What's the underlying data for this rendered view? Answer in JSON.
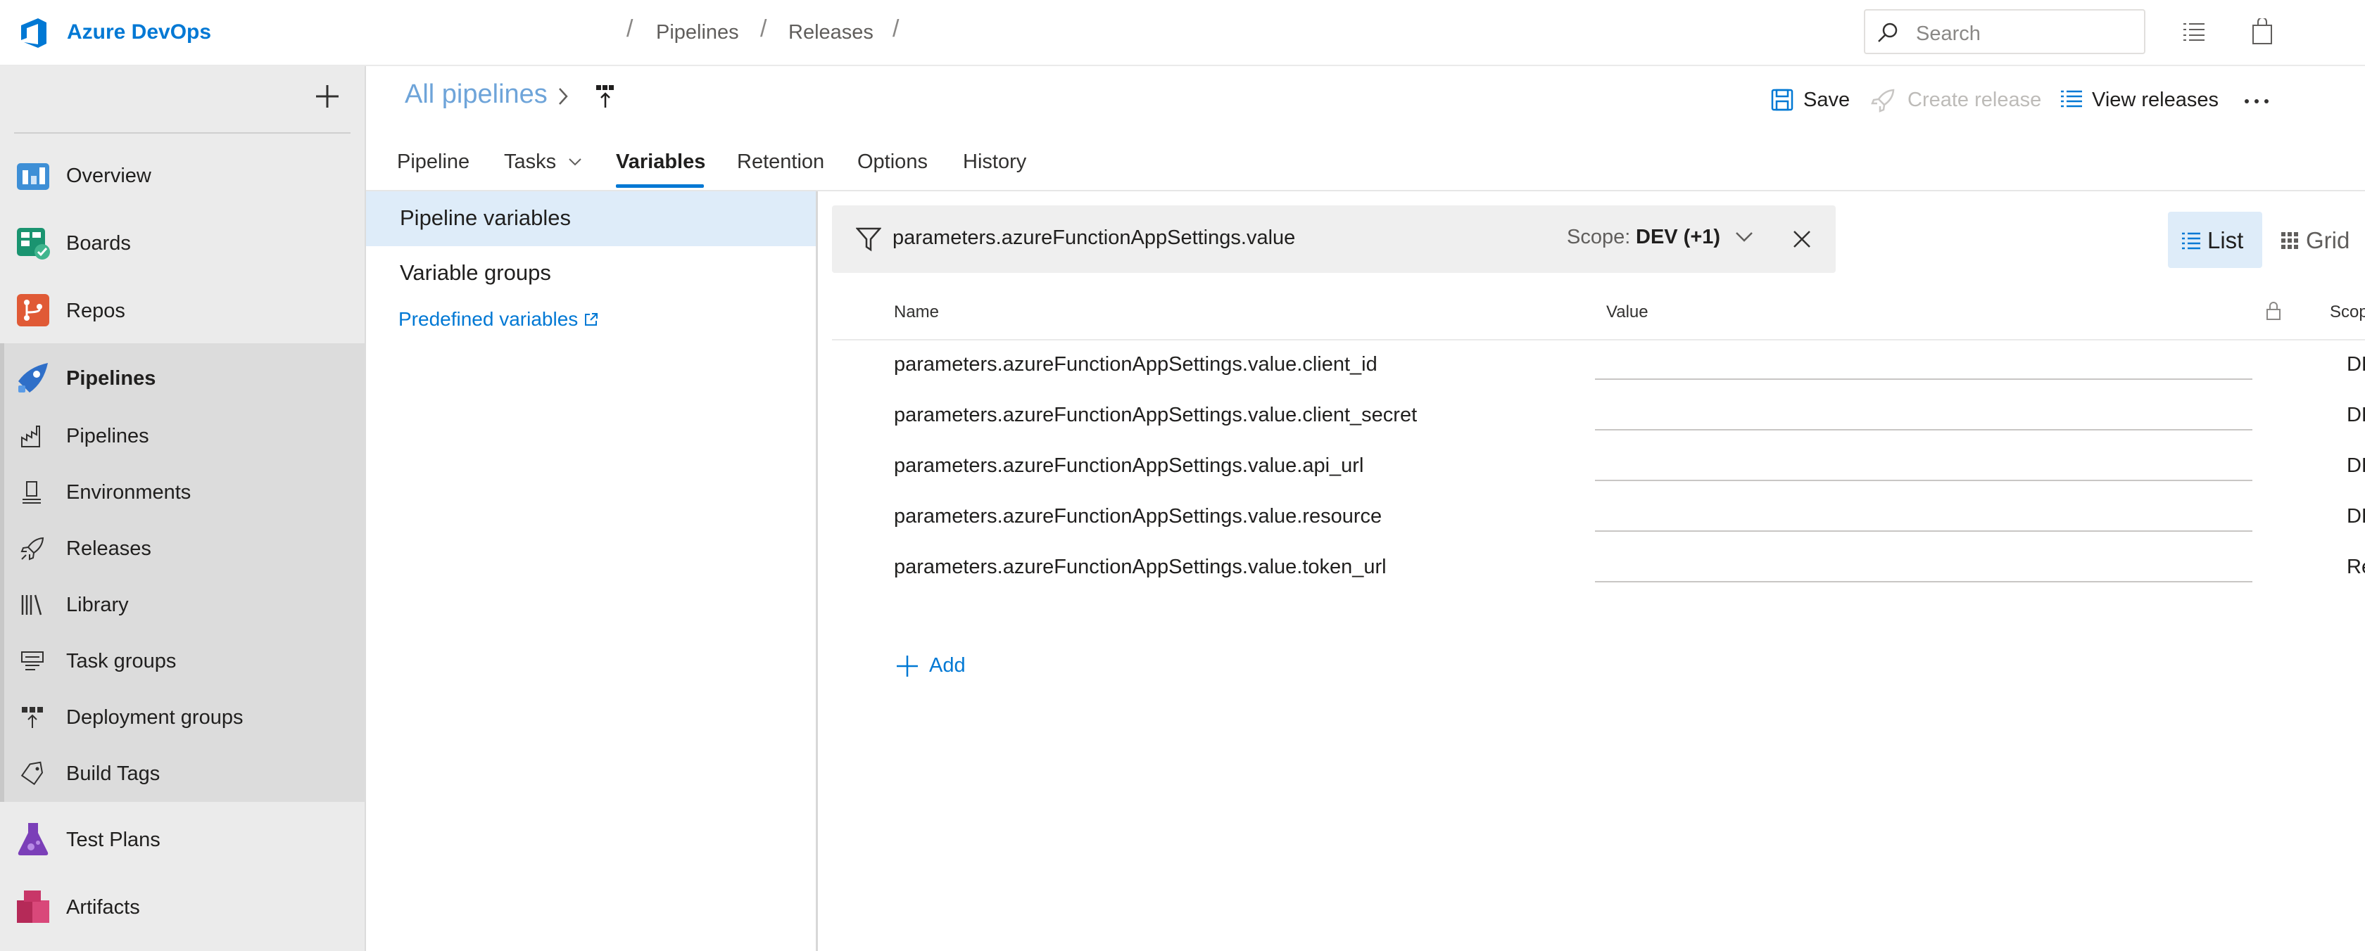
{
  "app": {
    "name": "Azure DevOps",
    "brand_color": "#0078d4"
  },
  "breadcrumb": {
    "items": [
      "Pipelines",
      "Releases"
    ]
  },
  "search": {
    "placeholder": "Search"
  },
  "nav": {
    "items": [
      {
        "label": "Overview",
        "icon": "overview-icon"
      },
      {
        "label": "Boards",
        "icon": "boards-icon"
      },
      {
        "label": "Repos",
        "icon": "repos-icon"
      },
      {
        "label": "Pipelines",
        "icon": "pipelines-icon"
      },
      {
        "label": "Test Plans",
        "icon": "test-plans-icon"
      },
      {
        "label": "Artifacts",
        "icon": "artifacts-icon"
      }
    ],
    "pipelines_sub": [
      {
        "label": "Pipelines",
        "icon": "pipelines-sub-icon"
      },
      {
        "label": "Environments",
        "icon": "environments-icon"
      },
      {
        "label": "Releases",
        "icon": "releases-icon"
      },
      {
        "label": "Library",
        "icon": "library-icon"
      },
      {
        "label": "Task groups",
        "icon": "task-groups-icon"
      },
      {
        "label": "Deployment groups",
        "icon": "deployment-groups-icon"
      },
      {
        "label": "Build Tags",
        "icon": "build-tags-icon"
      }
    ]
  },
  "header": {
    "all_pipelines": "All pipelines",
    "commands": {
      "save": "Save",
      "create_release": "Create release",
      "view_releases": "View releases"
    }
  },
  "tabs": {
    "pipeline": "Pipeline",
    "tasks": "Tasks",
    "variables": "Variables",
    "retention": "Retention",
    "options": "Options",
    "history": "History",
    "active": "Variables"
  },
  "variables_side": {
    "pipeline_variables": "Pipeline variables",
    "variable_groups": "Variable groups",
    "predefined_variables": "Predefined variables"
  },
  "filter": {
    "text": "parameters.azureFunctionAppSettings.value",
    "scope_label": "Scope:",
    "scope_value": "DEV (+1)"
  },
  "view_toggle": {
    "list": "List",
    "grid": "Grid",
    "selected": "List"
  },
  "table": {
    "headers": {
      "name": "Name",
      "value": "Value",
      "scope": "Scop"
    },
    "rows": [
      {
        "name": "parameters.azureFunctionAppSettings.value.client_id",
        "value": "",
        "scope": "DE"
      },
      {
        "name": "parameters.azureFunctionAppSettings.value.client_secret",
        "value": "",
        "scope": "DE"
      },
      {
        "name": "parameters.azureFunctionAppSettings.value.api_url",
        "value": "",
        "scope": "DE"
      },
      {
        "name": "parameters.azureFunctionAppSettings.value.resource",
        "value": "",
        "scope": "DE"
      },
      {
        "name": "parameters.azureFunctionAppSettings.value.token_url",
        "value": "",
        "scope": "Re"
      }
    ],
    "add_label": "Add"
  }
}
